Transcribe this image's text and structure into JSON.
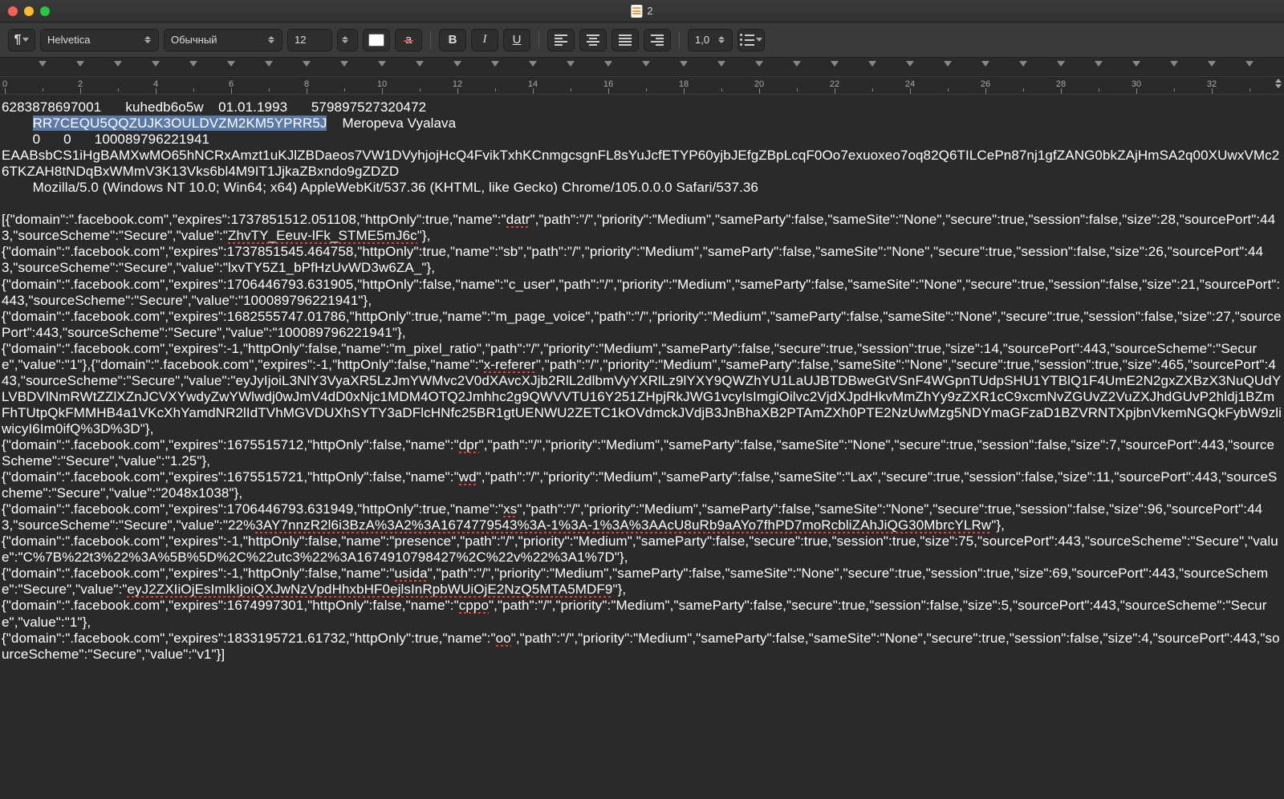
{
  "window": {
    "title": "2"
  },
  "toolbar": {
    "font": "Helvetica",
    "style": "Обычный",
    "size": "12",
    "lineSpacing": "1,0"
  },
  "ruler": {
    "labels": [
      "0",
      "2",
      "4",
      "6",
      "8",
      "10",
      "12",
      "14",
      "16",
      "18",
      "20",
      "22",
      "24",
      "26",
      "28",
      "30",
      "32"
    ]
  },
  "doc": {
    "row1": {
      "c1": "6283878697001",
      "c2": "kuhedb6o5w",
      "c3": "01.01.1993",
      "c4": "579897527320472"
    },
    "row2": {
      "indent": "\t",
      "c1": "RR7CEQU5QQZUJK3OULDVZM2KM5YPRR5J",
      "c2": "Meropeva Vyalava"
    },
    "row3": {
      "indent": "\t",
      "c1": "0",
      "c2": "0",
      "c3": "100089796221941"
    },
    "row4": "EAABsbCS1iHgBAMXwMO65hNCRxAmzt1uKJlZBDaeos7VW1DVyhjojHcQ4FvikTxhKCnmgcsgnFL8sYuJcfETYP60yjbJEfgZBpLcqF0Oo7exuoxeo7oq82Q6TILCePn87nj1gfZANG0bkZAjHmSA2q00XUwxVMc26TKZAH8tNDqBxWMmV3K13Vks6bl4M9IT1JjkaZBxndo9gZDZD",
    "row5": {
      "indent": "\t",
      "c1": "Mozilla/5.0 (Windows NT 10.0; Win64; x64) AppleWebKit/537.36 (KHTML, like Gecko) Chrome/105.0.0.0 Safari/537.36"
    },
    "cookies": [
      {
        "a": "[{\"domain\":\".facebook.com\",\"expires\":1737851512.051108,\"httpOnly\":true,\"name\":\"",
        "name": "datr",
        "b": "\",\"path\":\"/\",\"priority\":\"Medium\",\"sameParty\":false,\"sameSite\":\"None\",\"secure\":true,\"session\":false,\"size\":28,\"sourcePort\":443,\"sourceScheme\":\"Secure\",\"value\":\"",
        "val": "ZhvTY_Eeuv-lFk_STME5mJ6c",
        "c": "\"},"
      },
      {
        "a": "{\"domain\":\".facebook.com\",\"expires\":1737851545.464758,\"httpOnly\":true,\"name\":\"sb\",\"path\":\"/\",\"priority\":\"Medium\",\"sameParty\":false,\"sameSite\":\"None\",\"secure\":true,\"session\":false,\"size\":26,\"sourcePort\":443,\"sourceScheme\":\"Secure\",\"value\":\"lxvTY5Z1_bPfHzUvWD3w6ZA_\"},"
      },
      {
        "a": "{\"domain\":\".facebook.com\",\"expires\":1706446793.631905,\"httpOnly\":false,\"name\":\"c_user\",\"path\":\"/\",\"priority\":\"Medium\",\"sameParty\":false,\"sameSite\":\"None\",\"secure\":true,\"session\":false,\"size\":21,\"sourcePort\":443,\"sourceScheme\":\"Secure\",\"value\":\"100089796221941\"},"
      },
      {
        "a": "{\"domain\":\".facebook.com\",\"expires\":1682555747.01786,\"httpOnly\":true,\"name\":\"m_page_voice\",\"path\":\"/\",\"priority\":\"Medium\",\"sameParty\":false,\"sameSite\":\"None\",\"secure\":true,\"session\":false,\"size\":27,\"sourcePort\":443,\"sourceScheme\":\"Secure\",\"value\":\"100089796221941\"},"
      },
      {
        "a": "{\"domain\":\".facebook.com\",\"expires\":-1,\"httpOnly\":false,\"name\":\"m_pixel_ratio\",\"path\":\"/\",\"priority\":\"Medium\",\"sameParty\":false,\"secure\":true,\"session\":true,\"size\":14,\"sourcePort\":443,\"sourceScheme\":\"Secure\",\"value\":\"1\"},{\"domain\":\".facebook.com\",\"expires\":-1,\"httpOnly\":false,\"name\":\"",
        "name": "x-referer",
        "b": "\",\"path\":\"/\",\"priority\":\"Medium\",\"sameParty\":false,\"sameSite\":\"None\",\"secure\":true,\"session\":true,\"size\":465,\"sourcePort\":443,\"sourceScheme\":\"Secure\",\"value\":\"eyJyIjoiL3NlY3VyaXR5LzJmYWMvc2V0dXAvcXJjb2RlL2dlbmVyYXRlLz9lYXY9QWZhYU1LaUJBTDBweGtVSnF4WGpnTUdpSHU1YTBlQ1F4UmE2N2gxZXBzX3NuQUdYLVBDVlNmRWtZZlXZnJCVXYwdyZwYWlwdj0wJmV4dD0xNjc1MDM4OTQ2Jmhhc2g9QWVVTU16Y251ZHpjRkJWG1vcyIsImgiOilvc2VjdXJpdHkvMmZhYy9zZXR1cC9xcmNvZGUvZ2VuZXJhdGUvP2hldj1BZmFhTUtpQkFMMHB4a1VKcXhYamdNR2lIdTVhMGVDUXhSYTY3aDFlcHNfc25BR1gtUENWU2ZETC1kOVdmckJVdjB3JnBhaXB2PTAmZXh0PTE2NzUwMzg5NDYmaGFzaD1BZVRNTXpjbnVkemNGQkFybW9zliwicyI6Im0ifQ%3D%3D\"},"
      },
      {
        "a": "{\"domain\":\".facebook.com\",\"expires\":1675515712,\"httpOnly\":false,\"name\":\"",
        "name": "dpr",
        "b": "\",\"path\":\"/\",\"priority\":\"Medium\",\"sameParty\":false,\"sameSite\":\"None\",\"secure\":true,\"session\":false,\"size\":7,\"sourcePort\":443,\"sourceScheme\":\"Secure\",\"value\":\"1.25\"},"
      },
      {
        "a": "{\"domain\":\".facebook.com\",\"expires\":1675515721,\"httpOnly\":false,\"name\":\"",
        "name": "wd",
        "b": "\",\"path\":\"/\",\"priority\":\"Medium\",\"sameParty\":false,\"sameSite\":\"Lax\",\"secure\":true,\"session\":false,\"size\":11,\"sourcePort\":443,\"sourceScheme\":\"Secure\",\"value\":\"2048x1038\"},"
      },
      {
        "a": "{\"domain\":\".facebook.com\",\"expires\":1706446793.631949,\"httpOnly\":true,\"name\":\"",
        "name": "xs",
        "b": "\",\"path\":\"/\",\"priority\":\"Medium\",\"sameParty\":false,\"sameSite\":\"None\",\"secure\":true,\"session\":false,\"size\":96,\"sourcePort\":443,\"sourceScheme\":\"Secure\",\"value\":\"22%",
        "val": "3AY7nnzR2l6i3BzA%3A2%3A1674779543%3A-1%3A-1%3A%3AAcU8uRb9aAYo7fhPD7moRcbliZAhJiQG30MbrcYLRw",
        "c": "\"},"
      },
      {
        "a": "{\"domain\":\".facebook.com\",\"expires\":-1,\"httpOnly\":false,\"name\":\"presence\",\"path\":\"/\",\"priority\":\"Medium\",\"sameParty\":false,\"secure\":true,\"session\":true,\"size\":75,\"sourcePort\":443,\"sourceScheme\":\"Secure\",\"value\":\"C%7B%22t3%22%3A%5B%5D%2C%22utc3%22%3A1674910798427%2C%22v%22%3A1%7D\"},"
      },
      {
        "a": "{\"domain\":\".facebook.com\",\"expires\":-1,\"httpOnly\":false,\"name\":\"",
        "name": "usida",
        "b": "\",\"path\":\"/\",\"priority\":\"Medium\",\"sameParty\":false,\"sameSite\":\"None\",\"secure\":true,\"session\":true,\"size\":69,\"sourcePort\":443,\"sourceScheme\":\"Secure\",\"value\":\"",
        "val": "eyJ2ZXIiOjEsImlkIjoiQXJwNzVpdHhxbHF0ejlsInRpbWUiOjE2NzQ5MTA5MDF9",
        "c": "\"},"
      },
      {
        "a": "{\"domain\":\".facebook.com\",\"expires\":1674997301,\"httpOnly\":false,\"name\":\"",
        "name": "cppo",
        "b": "\",\"path\":\"/\",\"priority\":\"Medium\",\"sameParty\":false,\"secure\":true,\"session\":false,\"size\":5,\"sourcePort\":443,\"sourceScheme\":\"Secure\",\"value\":\"1\"},"
      },
      {
        "a": "{\"domain\":\".facebook.com\",\"expires\":1833195721.61732,\"httpOnly\":true,\"name\":\"",
        "name": "oo",
        "b": "\",\"path\":\"/\",\"priority\":\"Medium\",\"sameParty\":false,\"sameSite\":\"None\",\"secure\":true,\"session\":false,\"size\":4,\"sourcePort\":443,\"sourceScheme\":\"Secure\",\"value\":\"v1\"}]"
      }
    ]
  }
}
